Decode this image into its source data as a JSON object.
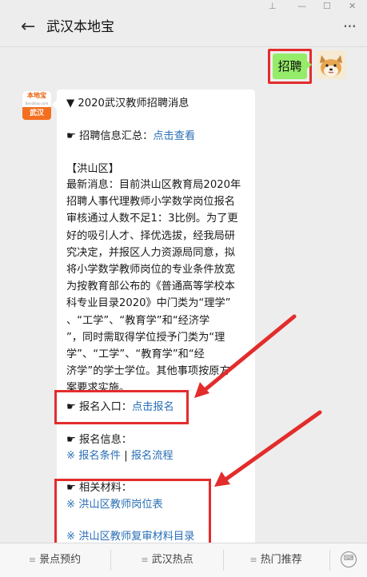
{
  "window": {
    "pin_label": "⊥",
    "minimize_label": "—",
    "maximize_label": "☐",
    "close_label": "✕"
  },
  "header": {
    "back_label": "←",
    "title": "武汉本地宝",
    "more_label": "···"
  },
  "user_message": {
    "text": "招聘"
  },
  "bot_avatar": {
    "brand": "本地宝",
    "url": "Bendibao.com",
    "city": "武汉"
  },
  "article": {
    "heading": "▼ 2020武汉教师招聘消息",
    "summary_label": "☛ 招聘信息汇总：",
    "summary_link": "点击查看",
    "district": "【洪山区】",
    "news_lines": [
      "最新消息：目前洪山区教育局2020年",
      "招聘人事代理教师小学数学岗位报名",
      "审核通过人数不足1：3比例。为了更",
      "好的吸引人才、择优选拔，经我局研",
      "究决定，并报区人力资源局同意，拟",
      "将小学数学教师岗位的专业条件放宽",
      "为按教育部公布的《普通高等学校本",
      "科专业目录2020》中门类为“理学”",
      "、“工学”、“教育学”和“经济学",
      "”，同时需取得学位授予门类为“理",
      "学”、“工学”、“教育学”和“经",
      "济学”的学士学位。其他事项按原方",
      "案要求实施。"
    ],
    "signup_label": "☛ 报名入口：",
    "signup_link": "点击报名",
    "info_label": "☛ 报名信息：",
    "info_prefix": "※ ",
    "info_link1": "报名条件",
    "info_sep": " | ",
    "info_link2": "报名流程",
    "materials_label": "☛ 相关材料：",
    "materials_prefix": "※ ",
    "materials_link1": "洪山区教师岗位表",
    "materials_link2": "洪山区教师复审材料目录"
  },
  "bottom_menu": {
    "items": [
      {
        "label": "景点预约"
      },
      {
        "label": "武汉热点"
      },
      {
        "label": "热门推荐"
      }
    ],
    "menu_icon": "≡",
    "keyboard_label": "⌨"
  },
  "colors": {
    "accent_link": "#2a6fb5",
    "highlight": "#e32c2c",
    "user_bubble": "#95ec69"
  }
}
